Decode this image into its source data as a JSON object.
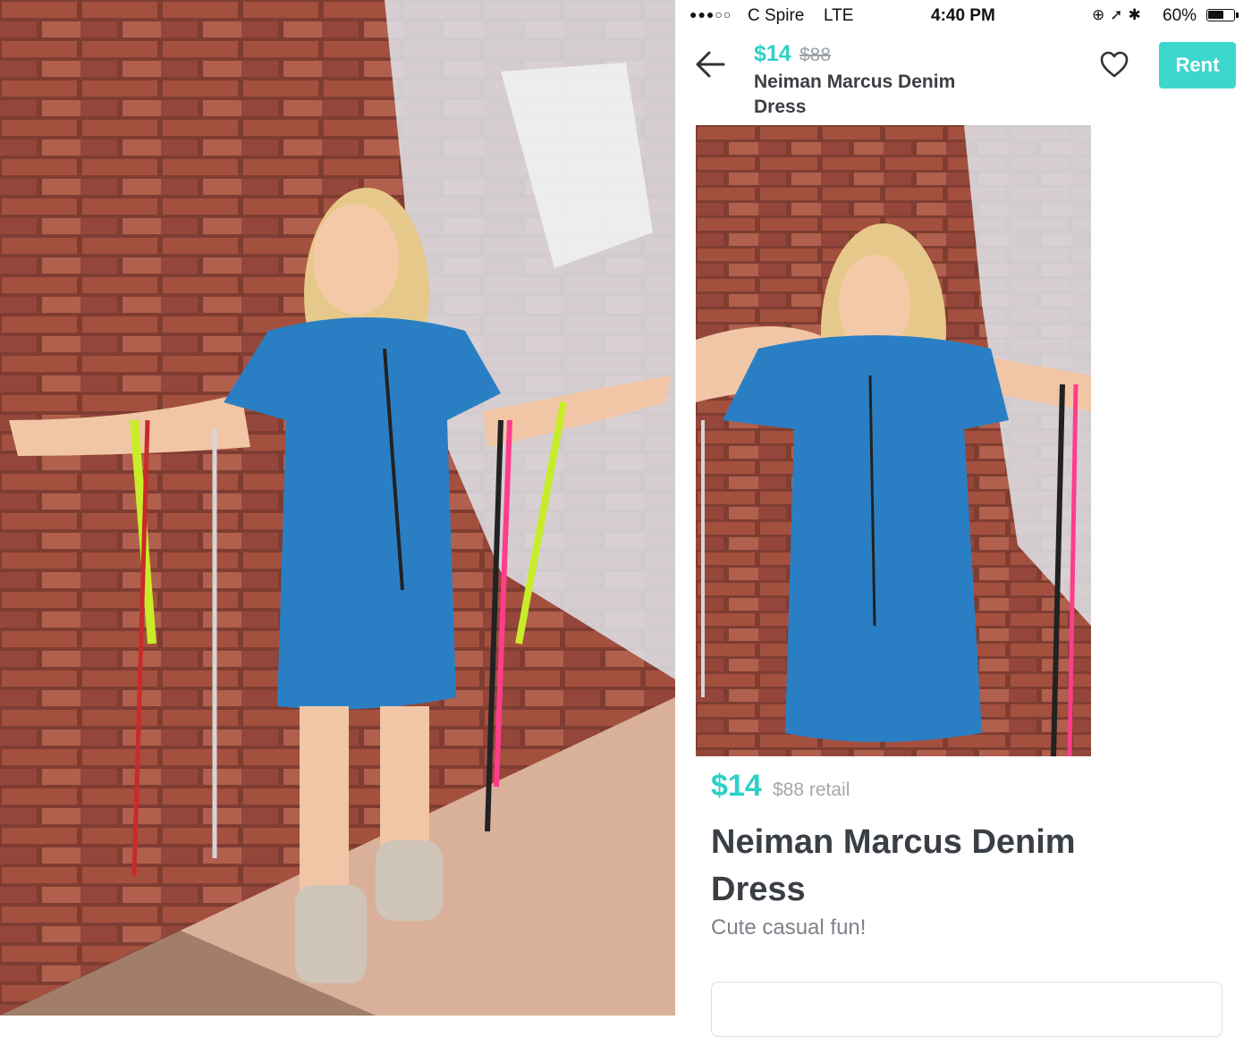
{
  "status_bar": {
    "signal": "●●●○○",
    "carrier": "C Spire",
    "network": "LTE",
    "time": "4:40 PM",
    "icons": "lock-rotation-icon location-icon bluetooth-icon",
    "battery_percent": "60%"
  },
  "header": {
    "price": "$14",
    "retail_price": "$88",
    "title": "Neiman Marcus Denim Dress",
    "rent_label": "Rent"
  },
  "product": {
    "price": "$14",
    "retail_label": "$88 retail",
    "title": "Neiman Marcus Denim Dress",
    "description": "Cute casual fun!"
  },
  "colors": {
    "accent": "#2fd0c7",
    "rent_button": "#3dd6cf",
    "title_text": "#3a3f45",
    "muted_text": "#9aa0a6",
    "dress_blue": "#2a7fc4",
    "brick_red": "#9c4a3d"
  },
  "icons": {
    "back": "back-arrow-icon",
    "favorite": "heart-icon"
  }
}
